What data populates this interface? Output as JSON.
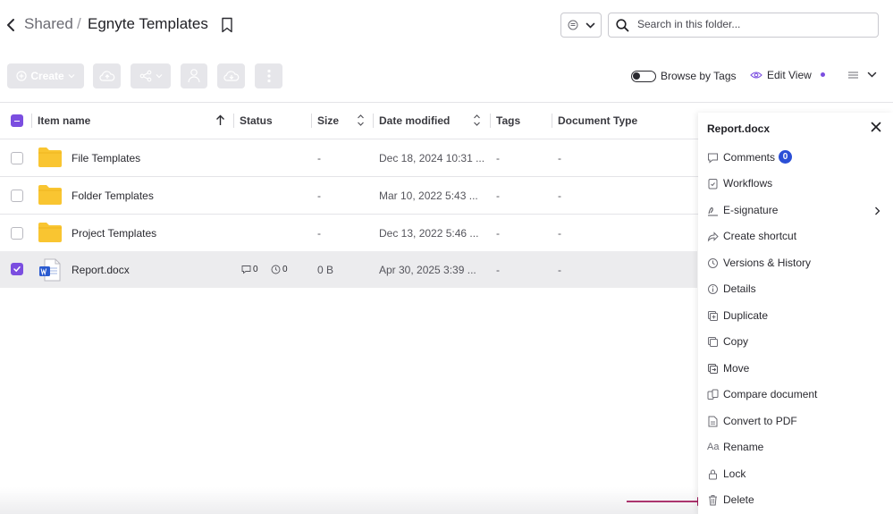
{
  "header": {
    "breadcrumb_parent": "Shared",
    "breadcrumb_separator": "/",
    "breadcrumb_current": "Egnyte Templates"
  },
  "search": {
    "placeholder": "Search in this folder..."
  },
  "toolbar": {
    "create_label": "Create",
    "browse_by_tags_label": "Browse by Tags",
    "edit_view_label": "Edit View"
  },
  "table": {
    "columns": {
      "name": "Item name",
      "status": "Status",
      "size": "Size",
      "modified": "Date modified",
      "tags": "Tags",
      "doctype": "Document Type"
    },
    "rows": [
      {
        "name": "File Templates",
        "size": "-",
        "modified": "Dec 18, 2024 10:31 ...",
        "tags": "-",
        "doctype": "-",
        "type": "folder",
        "selected": false
      },
      {
        "name": "Folder Templates",
        "size": "-",
        "modified": "Mar 10, 2022 5:43 ...",
        "tags": "-",
        "doctype": "-",
        "type": "folder",
        "selected": false
      },
      {
        "name": "Project Templates",
        "size": "-",
        "modified": "Dec 13, 2022 5:46 ...",
        "tags": "-",
        "doctype": "-",
        "type": "folder",
        "selected": false
      },
      {
        "name": "Report.docx",
        "size": "0 B",
        "modified": "Apr 30, 2025 3:39 ...",
        "tags": "-",
        "doctype": "-",
        "type": "word",
        "selected": true,
        "comments": "0",
        "versions": "0"
      }
    ]
  },
  "panel": {
    "title": "Report.docx",
    "comments_count": "0",
    "items": [
      {
        "label": "Comments",
        "icon": "comment-icon"
      },
      {
        "label": "Workflows",
        "icon": "workflow-icon"
      },
      {
        "label": "E-signature",
        "icon": "signature-icon"
      },
      {
        "label": "Create shortcut",
        "icon": "shortcut-icon"
      },
      {
        "label": "Versions & History",
        "icon": "history-icon"
      },
      {
        "label": "Details",
        "icon": "info-icon"
      },
      {
        "label": "Duplicate",
        "icon": "duplicate-icon"
      },
      {
        "label": "Copy",
        "icon": "copy-icon"
      },
      {
        "label": "Move",
        "icon": "move-icon"
      },
      {
        "label": "Compare document",
        "icon": "compare-icon"
      },
      {
        "label": "Convert to PDF",
        "icon": "pdf-icon"
      },
      {
        "label": "Rename",
        "icon": "rename-icon"
      },
      {
        "label": "Lock",
        "icon": "lock-icon"
      },
      {
        "label": "Delete",
        "icon": "trash-icon"
      }
    ]
  },
  "colors": {
    "accent": "#7b4ee0",
    "badge": "#2b4fd6",
    "folder": "#f9c531",
    "arrow": "#a0185a",
    "selected_row": "#ececee"
  }
}
